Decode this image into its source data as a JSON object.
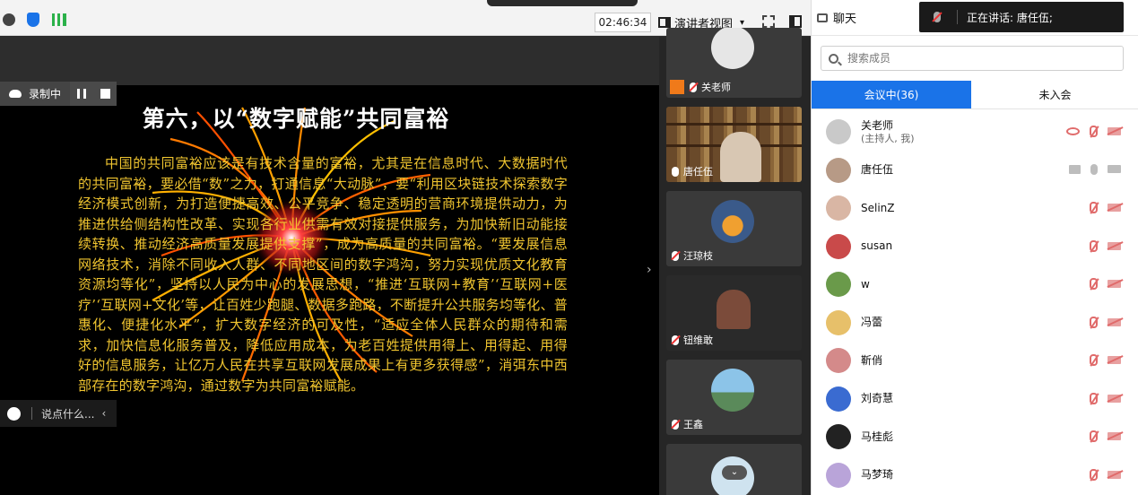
{
  "toolbar": {
    "timer": "02:46:34",
    "view_mode": "演讲者视图",
    "dropdown_arrow": "▾"
  },
  "recording": {
    "status": "录制中"
  },
  "slide": {
    "title": "第六，以“数字赋能”共同富裕",
    "body": "中国的共同富裕应该是有技术含量的富裕，尤其是在信息时代、大数据时代的共同富裕，要必借“数”之力，打通信息“大动脉”，要“利用区块链技术探索数字经济模式创新，为打造便捷高效、公平竞争、稳定透明的营商环境提供动力，为推进供给侧结构性改革、实现各行业供需有效对接提供服务，为加快新旧动能接续转换、推动经济高质量发展提供支撑”，成为高质量的共同富裕。“要发展信息网络技术，消除不同收入人群、不同地区间的数字鸿沟，努力实现优质文化教育资源均等化”，坚持以人民为中心的发展思想，“推进‘互联网+教育’‘互联网+医疗’‘互联网+文化’等，让百姓少跑腿、数据多跑路，不断提升公共服务均等化、普惠化、便捷化水平”，扩大数字经济的可及性，“适应全体人民群众的期待和需求，加快信息化服务普及，降低应用成本，为老百姓提供用得上、用得起、用得好的信息服务，让亿万人民在共享互联网发展成果上有更多获得感”，消弭东中西部存在的数字鸿沟，通过数字为共同富裕赋能。"
  },
  "chat_quick": {
    "placeholder": "说点什么..."
  },
  "video_strip": {
    "tiles": [
      {
        "name": "关老师"
      },
      {
        "name": "唐任伍"
      },
      {
        "name": "汪琼枝"
      },
      {
        "name": "钮维敢"
      },
      {
        "name": "王鑫"
      }
    ],
    "scroll_icon": "⌄"
  },
  "panel": {
    "header_title": "聊天",
    "speaking_toast": "正在讲话: 唐任伍;",
    "search_placeholder": "搜索成员",
    "tabs": [
      {
        "label": "会议中(36)"
      },
      {
        "label": "未入会"
      }
    ],
    "participants": [
      {
        "name": "关老师",
        "role": "(主持人, 我)",
        "avatar_color": "#c9c9c9"
      },
      {
        "name": "唐任伍",
        "role": "",
        "avatar_color": "#b79a86"
      },
      {
        "name": "SelinZ",
        "role": "",
        "avatar_color": "#d9b6a4"
      },
      {
        "name": "susan",
        "role": "",
        "avatar_color": "#c94a4a"
      },
      {
        "name": "w",
        "role": "",
        "avatar_color": "#6a9a4a"
      },
      {
        "name": "冯蕾",
        "role": "",
        "avatar_color": "#e7c06a"
      },
      {
        "name": "靳俏",
        "role": "",
        "avatar_color": "#d48a8a"
      },
      {
        "name": "刘奇慧",
        "role": "",
        "avatar_color": "#3a6bd1"
      },
      {
        "name": "马桂彪",
        "role": "",
        "avatar_color": "#222222"
      },
      {
        "name": "马梦琦",
        "role": "",
        "avatar_color": "#b9a4d9"
      }
    ]
  },
  "colors": {
    "accent": "#1a73e8",
    "slide_text": "#f0c530",
    "muted_red": "#e06b6b"
  }
}
